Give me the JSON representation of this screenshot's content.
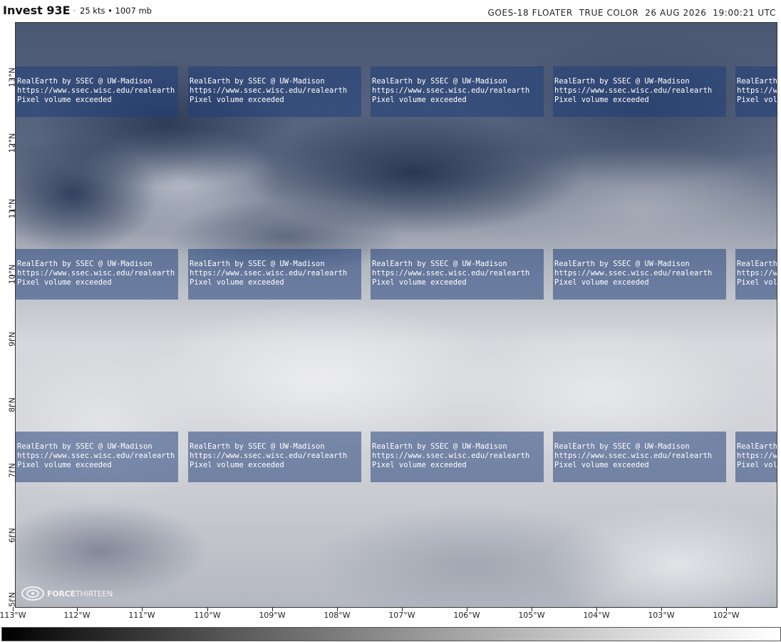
{
  "header": {
    "storm_name": "Invest 93E",
    "separator": "•",
    "storm_stats": "25 kts • 1007 mb",
    "sensor_info": "GOES-18 FLOATER  TRUE COLOR  26 AUG 2026  19:00:21 UTC"
  },
  "watermark": {
    "line1": "RealEarth by SSEC @ UW-Madison",
    "line2": "https://www.ssec.wisc.edu/realearth",
    "line3": "Pixel volume exceeded"
  },
  "lat_labels": [
    "13°N",
    "12°N",
    "11°N",
    "10°N",
    "9°N",
    "8°N",
    "7°N",
    "6°N",
    "5°N"
  ],
  "lon_labels": [
    "113°W",
    "112°W",
    "111°W",
    "110°W",
    "109°W",
    "108°W",
    "107°W",
    "106°W",
    "105°W",
    "104°W",
    "103°W",
    "102°W"
  ],
  "logo": {
    "word1": "FORCE",
    "word2": "THIRTEEN"
  },
  "colors": {
    "watermark_tile": "#1e3e78",
    "frame_border": "#333333"
  }
}
